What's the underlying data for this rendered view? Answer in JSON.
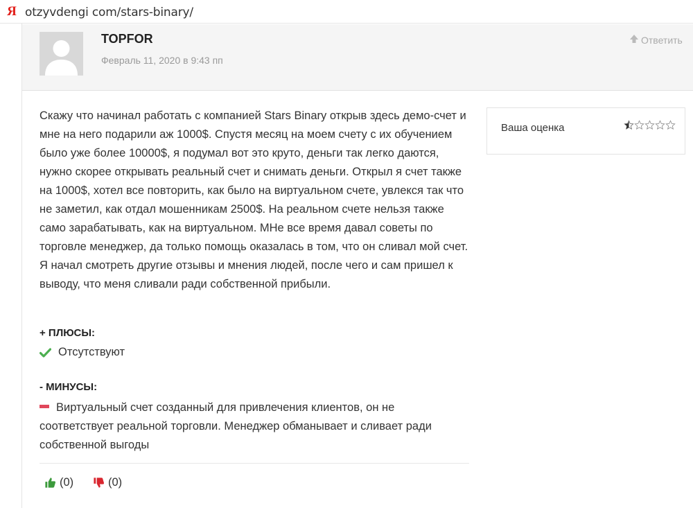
{
  "browser": {
    "url": "otzyvdengi com/stars-binary/",
    "logo_letter": "Я"
  },
  "comment": {
    "author": "TOPFOR",
    "date": "Февраль 11, 2020 в 9:43 пп",
    "reply_label": "Ответить",
    "body": "Скажу что начинал работать с компанией Stars Binary открыв здесь демо-счет и мне на него подарили аж 1000$. Спустя месяц на моем счету с их обучением было уже более 10000$, я подумал вот это круто, деньги так легко даются, нужно скорее открывать реальный счет и снимать деньги. Открыл я счет также на 1000$, хотел все повторить, как было на виртуальном счете, увлекся так что не заметил, как отдал мошенникам 2500$. На реальном счете нельзя также само зарабатывать, как на виртуальном. МНе все время давал советы по торговле менеджер, да только помощь оказалась в том, что он сливал мой счет. Я начал смотреть другие отзывы и мнения людей, после чего и сам пришел к выводу, что меня сливали ради собственной прибыли.",
    "pros_title": "+ ПЛЮСЫ:",
    "pros_text": "Отсутствуют",
    "cons_title": "- МИНУСЫ:",
    "cons_text": "Виртуальный счет созданный для привлечения клиентов, он не соответствует реальной торговли. Менеджер обманывает и сливает ради собственной выгоды",
    "likes": "(0)",
    "dislikes": "(0)"
  },
  "rating": {
    "label": "Ваша оценка",
    "value": 0.5,
    "max": 5
  },
  "icons": {
    "avatar": "default-avatar-icon",
    "reply": "arrow-up-icon",
    "pros": "checkmark-icon",
    "cons": "minus-icon",
    "like": "thumbs-up-icon",
    "dislike": "thumbs-down-icon"
  },
  "colors": {
    "check": "#4caf50",
    "minus": "#e0475b",
    "like": "#3c9a3c",
    "dislike": "#d9262f",
    "star": "#333333"
  }
}
